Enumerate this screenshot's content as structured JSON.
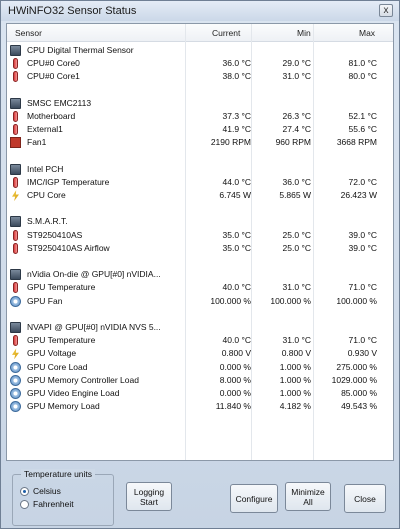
{
  "window": {
    "title": "HWiNFO32 Sensor Status",
    "close_glyph": "x"
  },
  "columns": {
    "sensor": "Sensor",
    "current": "Current",
    "min": "Min",
    "max": "Max"
  },
  "rows": [
    {
      "type": "group",
      "icon": "chip",
      "label": "CPU Digital Thermal Sensor",
      "current": "",
      "min": "",
      "max": ""
    },
    {
      "type": "item",
      "icon": "thermometer",
      "label": "CPU#0 Core0",
      "current": "36.0 °C",
      "min": "29.0 °C",
      "max": "81.0 °C"
    },
    {
      "type": "item",
      "icon": "thermometer",
      "label": "CPU#0 Core1",
      "current": "38.0 °C",
      "min": "31.0 °C",
      "max": "80.0 °C"
    },
    {
      "type": "blank",
      "icon": "",
      "label": "",
      "current": "",
      "min": "",
      "max": ""
    },
    {
      "type": "group",
      "icon": "chip",
      "label": "SMSC EMC2113",
      "current": "",
      "min": "",
      "max": ""
    },
    {
      "type": "item",
      "icon": "thermometer",
      "label": "Motherboard",
      "current": "37.3 °C",
      "min": "26.3 °C",
      "max": "52.1 °C"
    },
    {
      "type": "item",
      "icon": "thermometer",
      "label": "External1",
      "current": "41.9 °C",
      "min": "27.4 °C",
      "max": "55.6 °C"
    },
    {
      "type": "item",
      "icon": "fan",
      "label": "Fan1",
      "current": "2190 RPM",
      "min": "960 RPM",
      "max": "3668 RPM"
    },
    {
      "type": "blank",
      "icon": "",
      "label": "",
      "current": "",
      "min": "",
      "max": ""
    },
    {
      "type": "group",
      "icon": "chip",
      "label": "Intel PCH",
      "current": "",
      "min": "",
      "max": ""
    },
    {
      "type": "item",
      "icon": "thermometer",
      "label": "IMC/IGP Temperature",
      "current": "44.0 °C",
      "min": "36.0 °C",
      "max": "72.0 °C"
    },
    {
      "type": "item",
      "icon": "bolt",
      "label": "CPU Core",
      "current": "6.745 W",
      "min": "5.865 W",
      "max": "26.423 W"
    },
    {
      "type": "blank",
      "icon": "",
      "label": "",
      "current": "",
      "min": "",
      "max": ""
    },
    {
      "type": "group",
      "icon": "chip",
      "label": "S.M.A.R.T.",
      "current": "",
      "min": "",
      "max": ""
    },
    {
      "type": "item",
      "icon": "thermometer",
      "label": "ST9250410AS",
      "current": "35.0 °C",
      "min": "25.0 °C",
      "max": "39.0 °C"
    },
    {
      "type": "item",
      "icon": "thermometer",
      "label": "ST9250410AS Airflow",
      "current": "35.0 °C",
      "min": "25.0 °C",
      "max": "39.0 °C"
    },
    {
      "type": "blank",
      "icon": "",
      "label": "",
      "current": "",
      "min": "",
      "max": ""
    },
    {
      "type": "group",
      "icon": "chip",
      "label": "nVidia On-die @ GPU[#0] nVIDIA...",
      "current": "",
      "min": "",
      "max": ""
    },
    {
      "type": "item",
      "icon": "thermometer",
      "label": "GPU Temperature",
      "current": "40.0 °C",
      "min": "31.0 °C",
      "max": "71.0 °C"
    },
    {
      "type": "item",
      "icon": "gauge",
      "label": "GPU Fan",
      "current": "100.000 %",
      "min": "100.000 %",
      "max": "100.000 %"
    },
    {
      "type": "blank",
      "icon": "",
      "label": "",
      "current": "",
      "min": "",
      "max": ""
    },
    {
      "type": "group",
      "icon": "chip",
      "label": "NVAPI @ GPU[#0] nVIDIA NVS 5...",
      "current": "",
      "min": "",
      "max": ""
    },
    {
      "type": "item",
      "icon": "thermometer",
      "label": "GPU Temperature",
      "current": "40.0 °C",
      "min": "31.0 °C",
      "max": "71.0 °C"
    },
    {
      "type": "item",
      "icon": "bolt",
      "label": "GPU Voltage",
      "current": "0.800 V",
      "min": "0.800 V",
      "max": "0.930 V"
    },
    {
      "type": "item",
      "icon": "gauge",
      "label": "GPU Core Load",
      "current": "0.000 %",
      "min": "1.000 %",
      "max": "275.000 %"
    },
    {
      "type": "item",
      "icon": "gauge",
      "label": "GPU Memory Controller Load",
      "current": "8.000 %",
      "min": "1.000 %",
      "max": "1029.000 %"
    },
    {
      "type": "item",
      "icon": "gauge",
      "label": "GPU Video Engine Load",
      "current": "0.000 %",
      "min": "1.000 %",
      "max": "85.000 %"
    },
    {
      "type": "item",
      "icon": "gauge",
      "label": "GPU Memory Load",
      "current": "11.840 %",
      "min": "4.182 %",
      "max": "49.543 %"
    }
  ],
  "units_group": {
    "title": "Temperature units",
    "options": [
      {
        "label": "Celsius",
        "selected": true
      },
      {
        "label": "Fahrenheit",
        "selected": false
      }
    ]
  },
  "buttons": {
    "logging_line1": "Logging",
    "logging_line2": "Start",
    "configure": "Configure",
    "minimize_line1": "Minimize",
    "minimize_line2": "All",
    "close": "Close"
  }
}
